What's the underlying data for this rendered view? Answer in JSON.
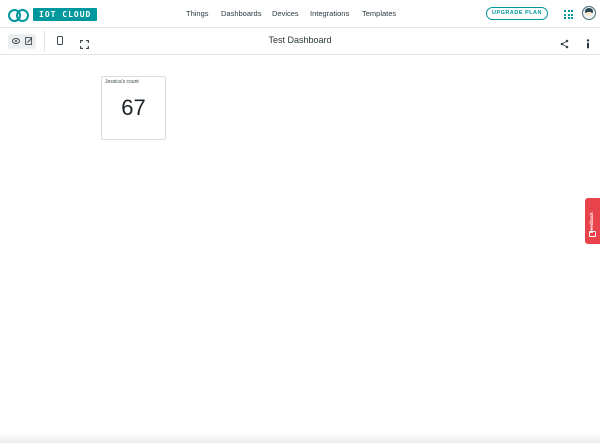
{
  "brand": {
    "logo_text": "IOT CLOUD",
    "accent_color": "#00979d"
  },
  "nav": {
    "items": [
      {
        "label": "Things"
      },
      {
        "label": "Dashboards"
      },
      {
        "label": "Devices"
      },
      {
        "label": "Integrations"
      },
      {
        "label": "Templates"
      }
    ],
    "upgrade_label": "UPGRADE PLAN",
    "apps_icon": "grid-icon",
    "avatar_icon": "user-avatar"
  },
  "toolbar": {
    "title": "Test Dashboard",
    "view_icon": "eye-icon",
    "edit_icon": "pencil-icon",
    "mobile_icon": "phone-icon",
    "fullscreen_icon": "expand-icon",
    "share_icon": "share-icon",
    "info_icon": "info-icon"
  },
  "widgets": [
    {
      "title": "Jessica's count",
      "value": "67"
    }
  ],
  "feedback": {
    "label": "Feedback",
    "color": "#e8434b"
  }
}
